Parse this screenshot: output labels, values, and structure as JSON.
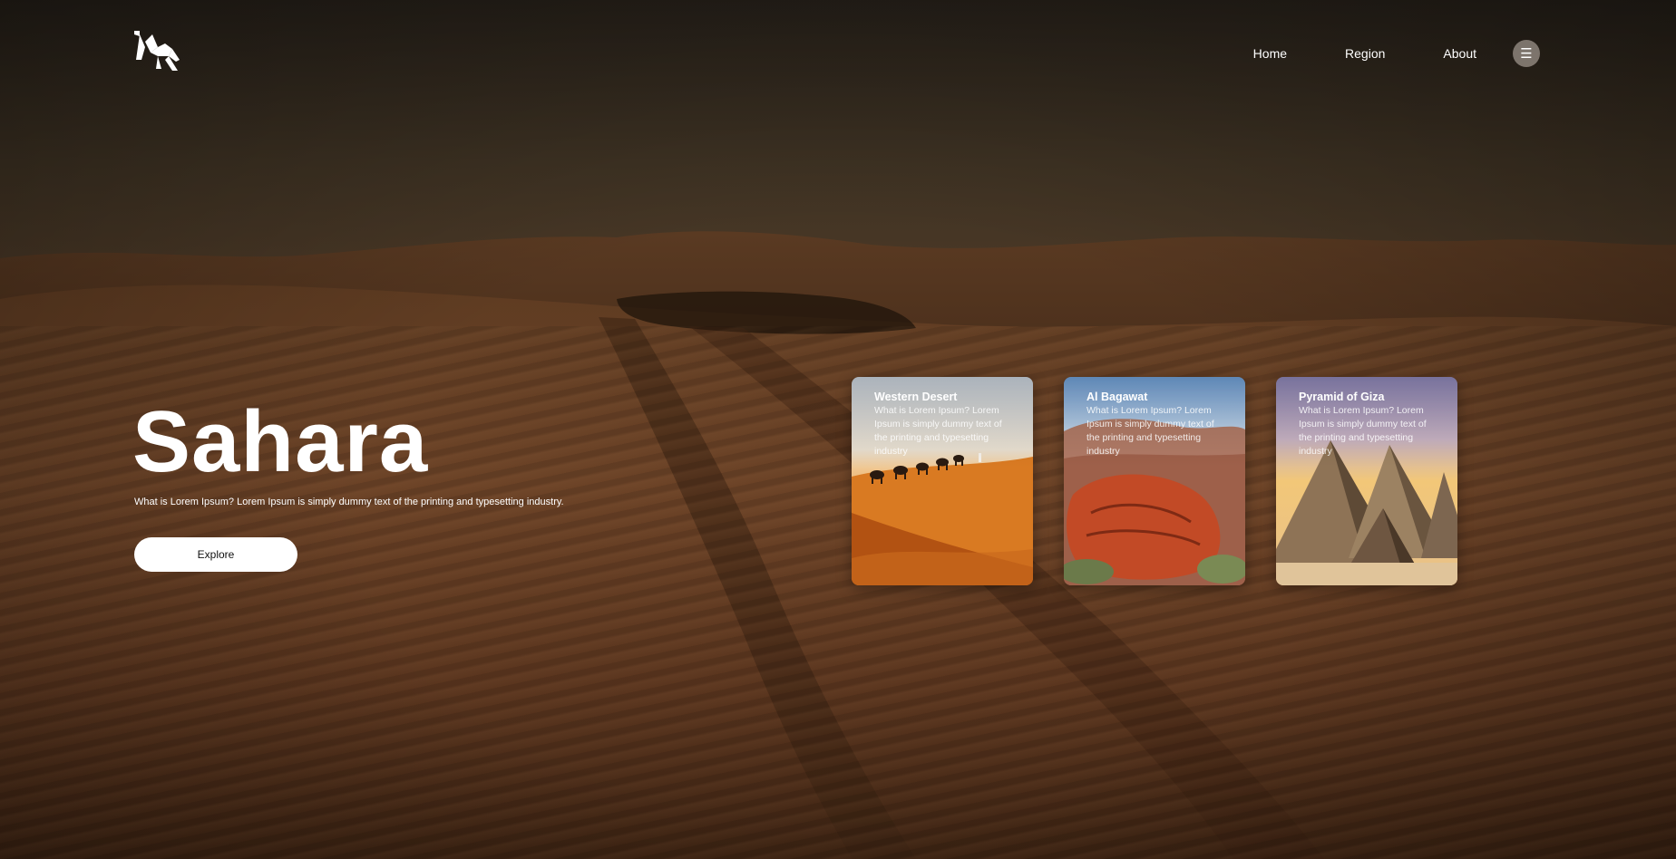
{
  "brand": {
    "logo_icon": "origami-camel-icon"
  },
  "nav": {
    "items": [
      {
        "label": "Home"
      },
      {
        "label": "Region"
      },
      {
        "label": "About"
      }
    ],
    "menu_icon": "☰"
  },
  "hero": {
    "title": "Sahara",
    "description": "What is Lorem Ipsum? Lorem Ipsum is simply dummy text of the printing and typesetting industry.",
    "cta_label": "Explore"
  },
  "cards": [
    {
      "title": "Western Desert",
      "text": "What is Lorem Ipsum? Lorem Ipsum is simply dummy text of the printing and typesetting industry"
    },
    {
      "title": "Al Bagawat",
      "text": "What is Lorem Ipsum? Lorem Ipsum is simply dummy text of the printing and typesetting industry"
    },
    {
      "title": "Pyramid of Giza",
      "text": "What is Lorem Ipsum? Lorem Ipsum is simply dummy text of the printing and typesetting industry"
    }
  ],
  "colors": {
    "text": "#ffffff",
    "button_bg": "#ffffff",
    "button_text": "#111111",
    "menu_button_bg": "#c8beb4"
  }
}
